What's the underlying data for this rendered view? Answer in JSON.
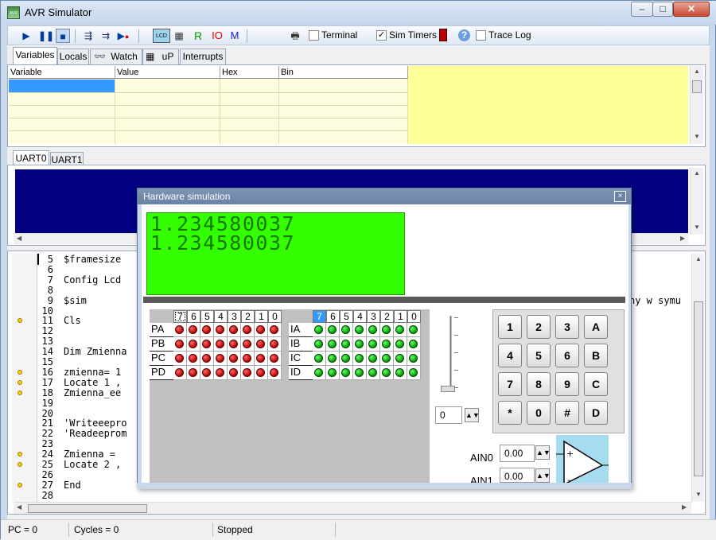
{
  "window": {
    "title": "AVR Simulator",
    "controls": [
      "0",
      "1",
      "r"
    ]
  },
  "toolbar": {
    "buttons": [
      "play",
      "pause",
      "stop",
      "step-into",
      "step-over",
      "run-to-cursor",
      "lcd",
      "chip",
      "R",
      "IO",
      "M"
    ],
    "terminal_label": "Terminal",
    "terminal_checked": false,
    "simtimers_label": "Sim Timers",
    "simtimers_checked": true,
    "tracelog_label": "Trace Log",
    "tracelog_checked": false
  },
  "top_tabs": [
    "Variables",
    "Locals",
    "Watch",
    "uP",
    "Interrupts"
  ],
  "variables_grid": {
    "columns": [
      "Variable",
      "Value",
      "Hex",
      "Bin"
    ]
  },
  "uart_tabs": [
    "UART0",
    "UART1"
  ],
  "code": {
    "lines": [
      {
        "n": "5",
        "text": "$framesize"
      },
      {
        "n": "6",
        "text": ""
      },
      {
        "n": "7",
        "text": "Config Lcd"
      },
      {
        "n": "8",
        "text": ""
      },
      {
        "n": "9",
        "text": "$sim"
      },
      {
        "n": "10",
        "text": ""
      },
      {
        "n": "11",
        "text": "Cls",
        "dot": true
      },
      {
        "n": "12",
        "text": ""
      },
      {
        "n": "13",
        "text": ""
      },
      {
        "n": "14",
        "text": "Dim Zmienna"
      },
      {
        "n": "15",
        "text": ""
      },
      {
        "n": "16",
        "text": "zmienna= 1",
        "dot": true
      },
      {
        "n": "17",
        "text": "Locate 1 ,",
        "dot": true
      },
      {
        "n": "18",
        "text": "Zmienna_ee",
        "dot": true
      },
      {
        "n": "19",
        "text": ""
      },
      {
        "n": "20",
        "text": ""
      },
      {
        "n": "21",
        "text": "'Writeeepro"
      },
      {
        "n": "22",
        "text": "'Readeeprom"
      },
      {
        "n": "23",
        "text": ""
      },
      {
        "n": "24",
        "text": "Zmienna = ",
        "dot": true
      },
      {
        "n": "25",
        "text": "Locate 2 ,",
        "dot": true
      },
      {
        "n": "26",
        "text": ""
      },
      {
        "n": "27",
        "text": "End",
        "dot": true
      },
      {
        "n": "28",
        "text": ""
      }
    ],
    "right_fragment": "ny w symu"
  },
  "status": {
    "pc": "PC = 0",
    "cycles": "Cycles = 0",
    "state": "Stopped"
  },
  "hw": {
    "title": "Hardware simulation",
    "close": "×",
    "lcd_lines": [
      "1.234580037",
      "1.234580037"
    ],
    "port_bits": [
      "7",
      "6",
      "5",
      "4",
      "3",
      "2",
      "1",
      "0"
    ],
    "out_ports": [
      "PA",
      "PB",
      "PC",
      "PD"
    ],
    "in_ports": [
      "IA",
      "IB",
      "IC",
      "ID"
    ],
    "slider_value": "0",
    "keys": [
      "1",
      "2",
      "3",
      "A",
      "4",
      "5",
      "6",
      "B",
      "7",
      "8",
      "9",
      "C",
      "*",
      "0",
      "#",
      "D"
    ],
    "ain0_label": "AIN0",
    "ain0_value": "0.00",
    "ain1_label": "AIN1",
    "ain1_value": "0.00",
    "opamp_plus": "+",
    "opamp_minus": "-"
  },
  "colors": {
    "led_out": "#c00000",
    "led_in": "#00a000",
    "lcd_bg": "#33ff00",
    "uart_bg": "#000080",
    "var_bg": "#ffff99"
  }
}
